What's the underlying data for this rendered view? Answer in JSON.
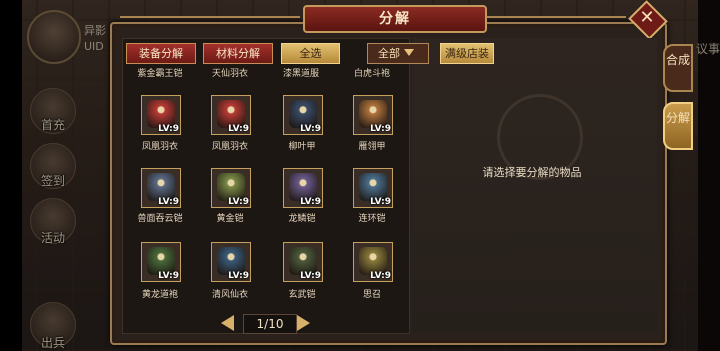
{
  "hud": {
    "player_name_partial": "异影",
    "uid_label": "UID",
    "side_buttons": [
      "首充",
      "签到",
      "活动",
      "出兵"
    ],
    "right_edge_text": "议事"
  },
  "dialog": {
    "title": "分解",
    "filters": {
      "tab_equipment": "装备分解",
      "tab_material": "材料分解",
      "select_all": "全选",
      "dropdown_value": "全部",
      "full_shop": "满级店装"
    },
    "top_row_names": [
      "紫金霸王铠",
      "天仙羽衣",
      "漆黑道服",
      "白虎斗袍"
    ],
    "items": [
      {
        "name": "凤凰羽衣",
        "level": "LV:9",
        "color": "#b93a35"
      },
      {
        "name": "凤凰羽衣",
        "level": "LV:9",
        "color": "#b93a35"
      },
      {
        "name": "柳叶甲",
        "level": "LV:9",
        "color": "#3a4b66"
      },
      {
        "name": "雁翎甲",
        "level": "LV:9",
        "color": "#b0723c"
      },
      {
        "name": "兽面吞云铠",
        "level": "LV:9",
        "color": "#5a6a84"
      },
      {
        "name": "黄金铠",
        "level": "LV:9",
        "color": "#7a8a45"
      },
      {
        "name": "龙鳞铠",
        "level": "LV:9",
        "color": "#6a5a8a"
      },
      {
        "name": "连环铠",
        "level": "LV:9",
        "color": "#4a6f8c"
      },
      {
        "name": "黄龙道袍",
        "level": "LV:9",
        "color": "#4a6a3a"
      },
      {
        "name": "清风仙衣",
        "level": "LV:9",
        "color": "#3a5b78"
      },
      {
        "name": "玄武铠",
        "level": "LV:9",
        "color": "#4d5a3a"
      },
      {
        "name": "思召",
        "level": "LV:9",
        "color": "#8a7a3a"
      }
    ],
    "pager": "1/10",
    "hint": "请选择要分解的物品",
    "side_tabs": [
      "合成",
      "分解"
    ]
  }
}
